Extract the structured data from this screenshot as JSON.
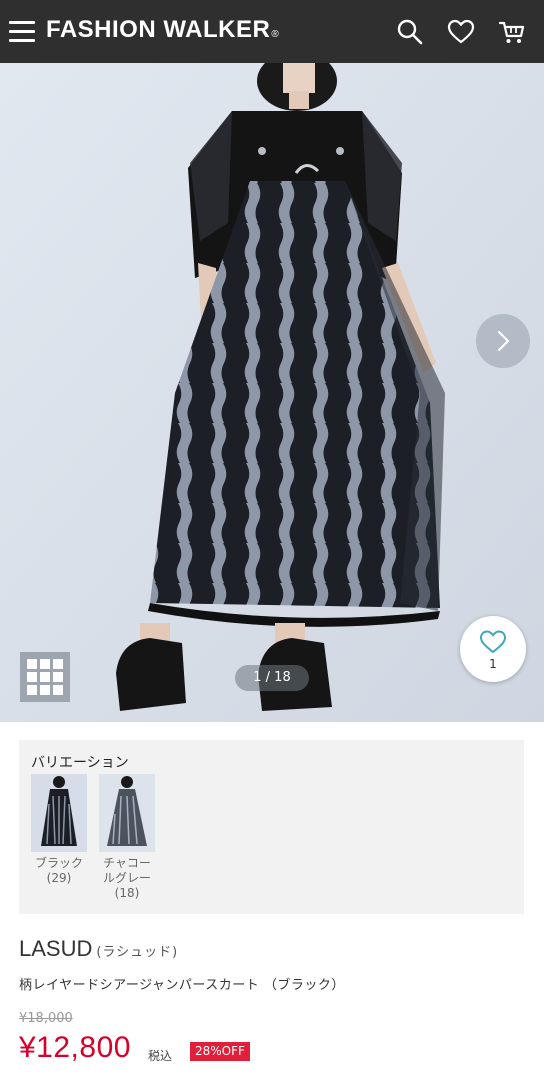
{
  "header": {
    "logo": "FASHION WALKER",
    "logo_mark": "®",
    "icons": [
      "menu-icon",
      "search-icon",
      "heart-icon",
      "cart-icon"
    ],
    "background": "#2f2f2f"
  },
  "gallery": {
    "counter": "1 / 18",
    "favorite_count": "1",
    "icons": [
      "chevron-right-icon",
      "grid-icon",
      "heart-outline-icon"
    ],
    "accent_color": "#3fa7b5"
  },
  "variation": {
    "title": "バリエーション",
    "items": [
      {
        "color": "ブラック",
        "stock": "(29)"
      },
      {
        "color_line1": "チャコー",
        "color_line2": "ルグレー",
        "stock": "(18)"
      }
    ]
  },
  "product": {
    "brand": "LASUD",
    "brand_kana": "(ラシュッド)",
    "name": "柄レイヤードシアージャンパースカート （ブラック）",
    "original_price": "¥18,000",
    "price": "¥12,800",
    "tax_label": "税込",
    "discount": "28%OFF",
    "price_color": "#d7002a"
  }
}
